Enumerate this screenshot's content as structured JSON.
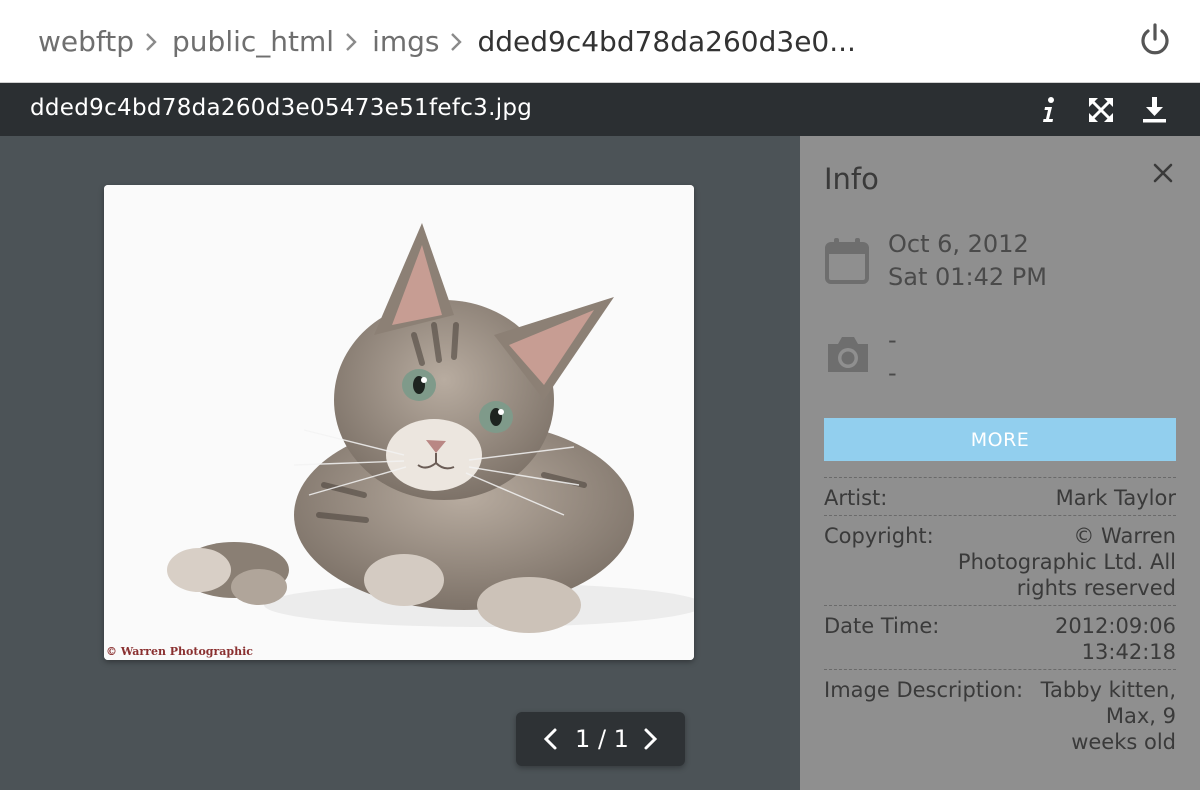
{
  "breadcrumb": {
    "items": [
      "webftp",
      "public_html",
      "imgs"
    ],
    "current": "dded9c4bd78da260d3e0..."
  },
  "toolbar": {
    "filename": "dded9c4bd78da260d3e05473e51fefc3.jpg",
    "icons": [
      "info-icon",
      "fullscreen-icon",
      "download-icon"
    ]
  },
  "viewer": {
    "watermark": "© Warren Photographic",
    "pager": {
      "text": "1 / 1"
    }
  },
  "info": {
    "title": "Info",
    "date_line1": "Oct 6, 2012",
    "date_line2": "Sat 01:42 PM",
    "camera_line1": "-",
    "camera_line2": "-",
    "more_label": "MORE",
    "properties": [
      {
        "key": "Artist:",
        "value": "Mark Taylor"
      },
      {
        "key": "Copyright:",
        "value": "© Warren Photographic Ltd. All rights reserved"
      },
      {
        "key": "Date Time:",
        "value": "2012:09:06 13:42:18"
      },
      {
        "key": "Image Description:",
        "value": "Tabby kitten, Max, 9 weeks old"
      }
    ]
  },
  "colors": {
    "accent": "#92cfee",
    "toolbar_bg": "#2b2f32",
    "viewer_bg": "#4c5357",
    "panel_bg": "#8f8f8f"
  }
}
